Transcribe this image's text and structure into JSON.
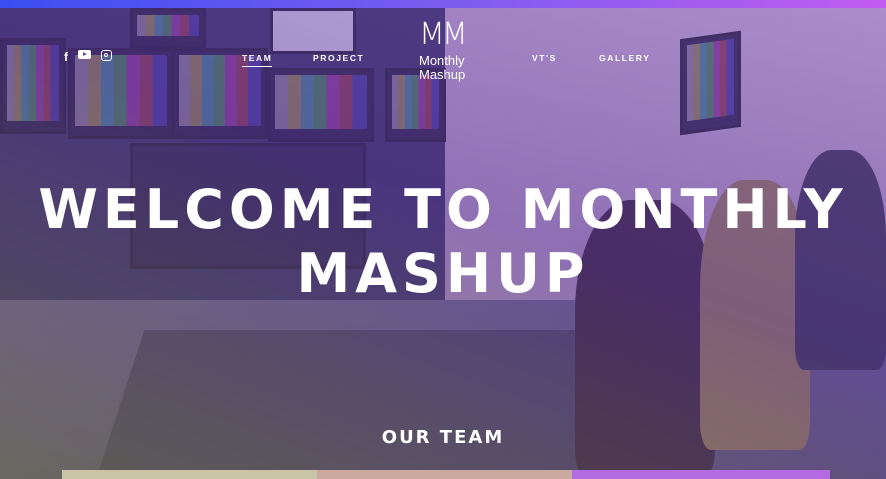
{
  "social": {
    "icons": [
      "facebook-icon",
      "youtube-icon",
      "instagram-icon"
    ],
    "facebook_glyph": "f"
  },
  "nav": {
    "items": [
      {
        "label": "TEAM",
        "active": true
      },
      {
        "label": "PROJECT",
        "active": false
      },
      {
        "label": "VT'S",
        "active": false
      },
      {
        "label": "GALLERY",
        "active": false
      }
    ]
  },
  "logo": {
    "mark": "MM",
    "line1": "Monthly",
    "line2": "Mashup"
  },
  "hero": {
    "line1": "WELCOME TO MONTHLY",
    "line2": "MASHUP"
  },
  "section": {
    "title": "OUR TEAM"
  },
  "colors": {
    "topbar_start": "#3b4ef2",
    "topbar_end": "#c25cf0",
    "overlay": "#8a5ad2"
  }
}
